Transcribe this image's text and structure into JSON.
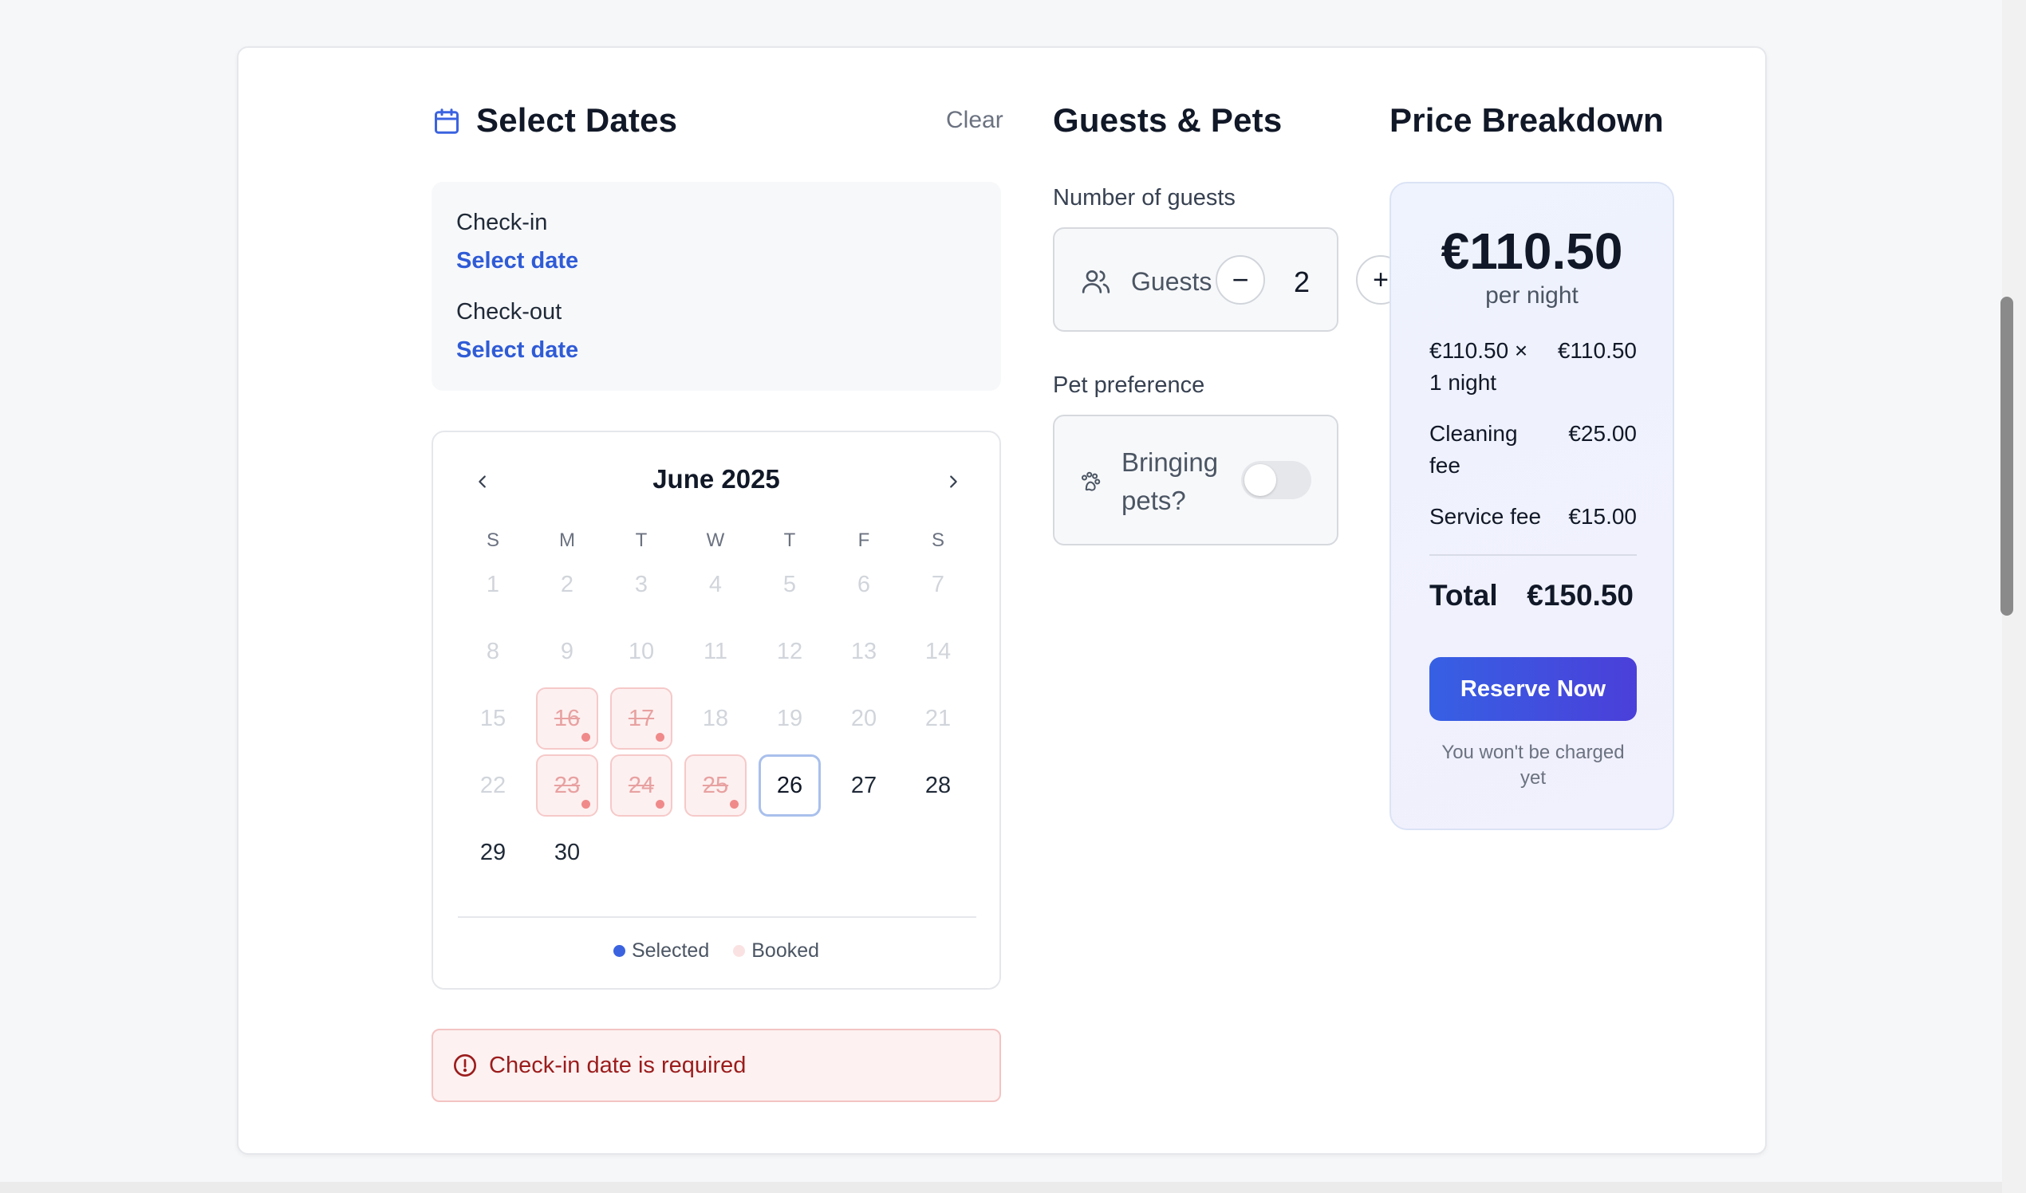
{
  "dates": {
    "title": "Select Dates",
    "clear_label": "Clear",
    "checkin_label": "Check-in",
    "checkin_value": "Select date",
    "checkout_label": "Check-out",
    "checkout_value": "Select date"
  },
  "calendar": {
    "month_label": "June 2025",
    "weekdays": [
      "S",
      "M",
      "T",
      "W",
      "T",
      "F",
      "S"
    ],
    "days": [
      {
        "d": "1",
        "state": "disabled"
      },
      {
        "d": "2",
        "state": "disabled"
      },
      {
        "d": "3",
        "state": "disabled"
      },
      {
        "d": "4",
        "state": "disabled"
      },
      {
        "d": "5",
        "state": "disabled"
      },
      {
        "d": "6",
        "state": "disabled"
      },
      {
        "d": "7",
        "state": "disabled"
      },
      {
        "d": "8",
        "state": "disabled"
      },
      {
        "d": "9",
        "state": "disabled"
      },
      {
        "d": "10",
        "state": "disabled"
      },
      {
        "d": "11",
        "state": "disabled"
      },
      {
        "d": "12",
        "state": "disabled"
      },
      {
        "d": "13",
        "state": "disabled"
      },
      {
        "d": "14",
        "state": "disabled"
      },
      {
        "d": "15",
        "state": "disabled"
      },
      {
        "d": "16",
        "state": "booked"
      },
      {
        "d": "17",
        "state": "booked"
      },
      {
        "d": "18",
        "state": "disabled"
      },
      {
        "d": "19",
        "state": "disabled"
      },
      {
        "d": "20",
        "state": "disabled"
      },
      {
        "d": "21",
        "state": "disabled"
      },
      {
        "d": "22",
        "state": "disabled"
      },
      {
        "d": "23",
        "state": "booked"
      },
      {
        "d": "24",
        "state": "booked"
      },
      {
        "d": "25",
        "state": "booked"
      },
      {
        "d": "26",
        "state": "today"
      },
      {
        "d": "27",
        "state": "available"
      },
      {
        "d": "28",
        "state": "available"
      },
      {
        "d": "29",
        "state": "available"
      },
      {
        "d": "30",
        "state": "available"
      }
    ],
    "legend_selected": "Selected",
    "legend_booked": "Booked",
    "selected_color": "#3b63e0",
    "booked_color": "#fbe2e2"
  },
  "error": {
    "message": "Check-in date is required"
  },
  "guests": {
    "title": "Guests & Pets",
    "number_label": "Number of guests",
    "guests_text": "Guests",
    "count": "2",
    "minus_symbol": "−",
    "plus_symbol": "+",
    "pet_label": "Pet preference",
    "pets_text": "Bringing pets?",
    "pets_enabled": false
  },
  "price": {
    "title": "Price Breakdown",
    "nightly": "€110.50",
    "per_night": "per night",
    "rows": [
      {
        "label": "€110.50 × 1 night",
        "value": "€110.50"
      },
      {
        "label": "Cleaning fee",
        "value": "€25.00"
      },
      {
        "label": "Service fee",
        "value": "€15.00"
      }
    ],
    "total_label": "Total",
    "total_value": "€150.50",
    "reserve_label": "Reserve Now",
    "charge_note": "You won't be charged yet"
  },
  "colors": {
    "accent": "#2f5bd6",
    "error_text": "#9b1c1c",
    "error_bg": "#fdf1f1"
  }
}
